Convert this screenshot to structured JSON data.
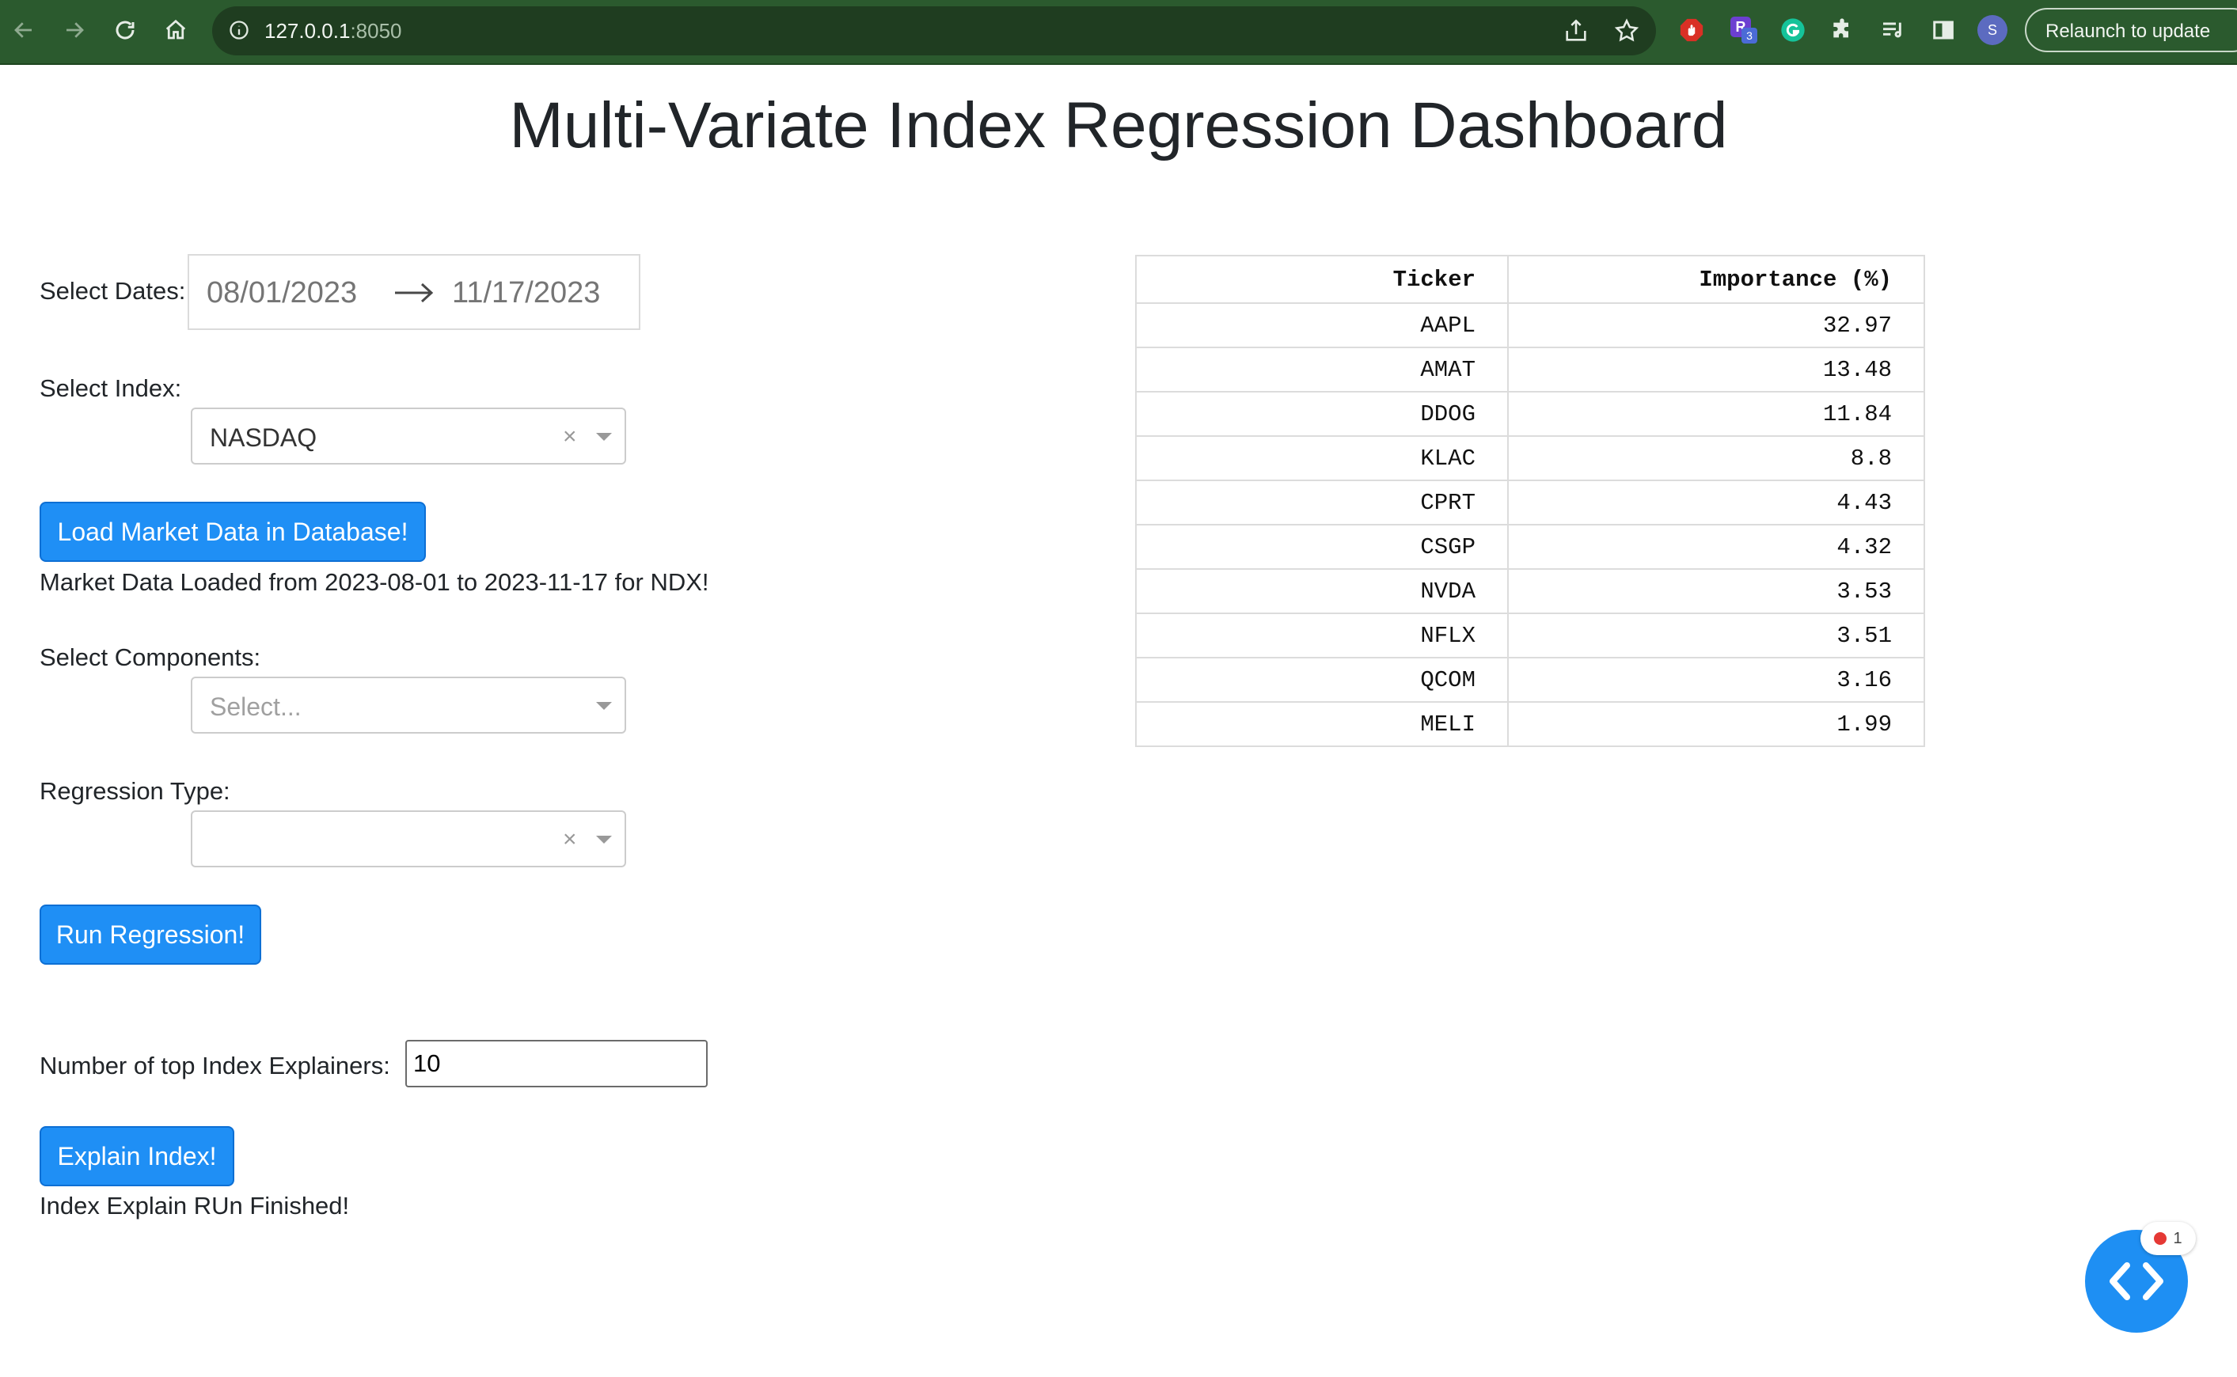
{
  "browser": {
    "url_host": "127.0.0.1",
    "url_port": ":8050",
    "relaunch_label": "Relaunch to update",
    "profile_initial": "S",
    "ext_badge_count": "3",
    "colors": {
      "toolbar": "#2b5a2e"
    }
  },
  "page": {
    "title": "Multi-Variate Index Regression Dashboard"
  },
  "controls": {
    "dates_label": "Select Dates:",
    "start_date": "08/01/2023",
    "end_date": "11/17/2023",
    "index_label": "Select Index:",
    "index_value": "NASDAQ",
    "load_button": "Load Market Data in Database!",
    "load_status": "Market Data Loaded from 2023-08-01 to 2023-11-17 for NDX!",
    "components_label": "Select Components:",
    "components_placeholder": "Select...",
    "regression_label": "Regression Type:",
    "regression_value": "",
    "run_button": "Run Regression!",
    "explainers_label": "Number of top Index Explainers:",
    "explainers_value": "10",
    "explain_button": "Explain Index!",
    "explain_status": "Index Explain RUn Finished!"
  },
  "table": {
    "headers": [
      "Ticker",
      "Importance (%)"
    ],
    "rows": [
      [
        "AAPL",
        "32.97"
      ],
      [
        "AMAT",
        "13.48"
      ],
      [
        "DDOG",
        "11.84"
      ],
      [
        "KLAC",
        "8.8"
      ],
      [
        "CPRT",
        "4.43"
      ],
      [
        "CSGP",
        "4.32"
      ],
      [
        "NVDA",
        "3.53"
      ],
      [
        "NFLX",
        "3.51"
      ],
      [
        "QCOM",
        "3.16"
      ],
      [
        "MELI",
        "1.99"
      ]
    ]
  },
  "debug": {
    "badge_count": "1",
    "accent": "#1e8ff3"
  }
}
